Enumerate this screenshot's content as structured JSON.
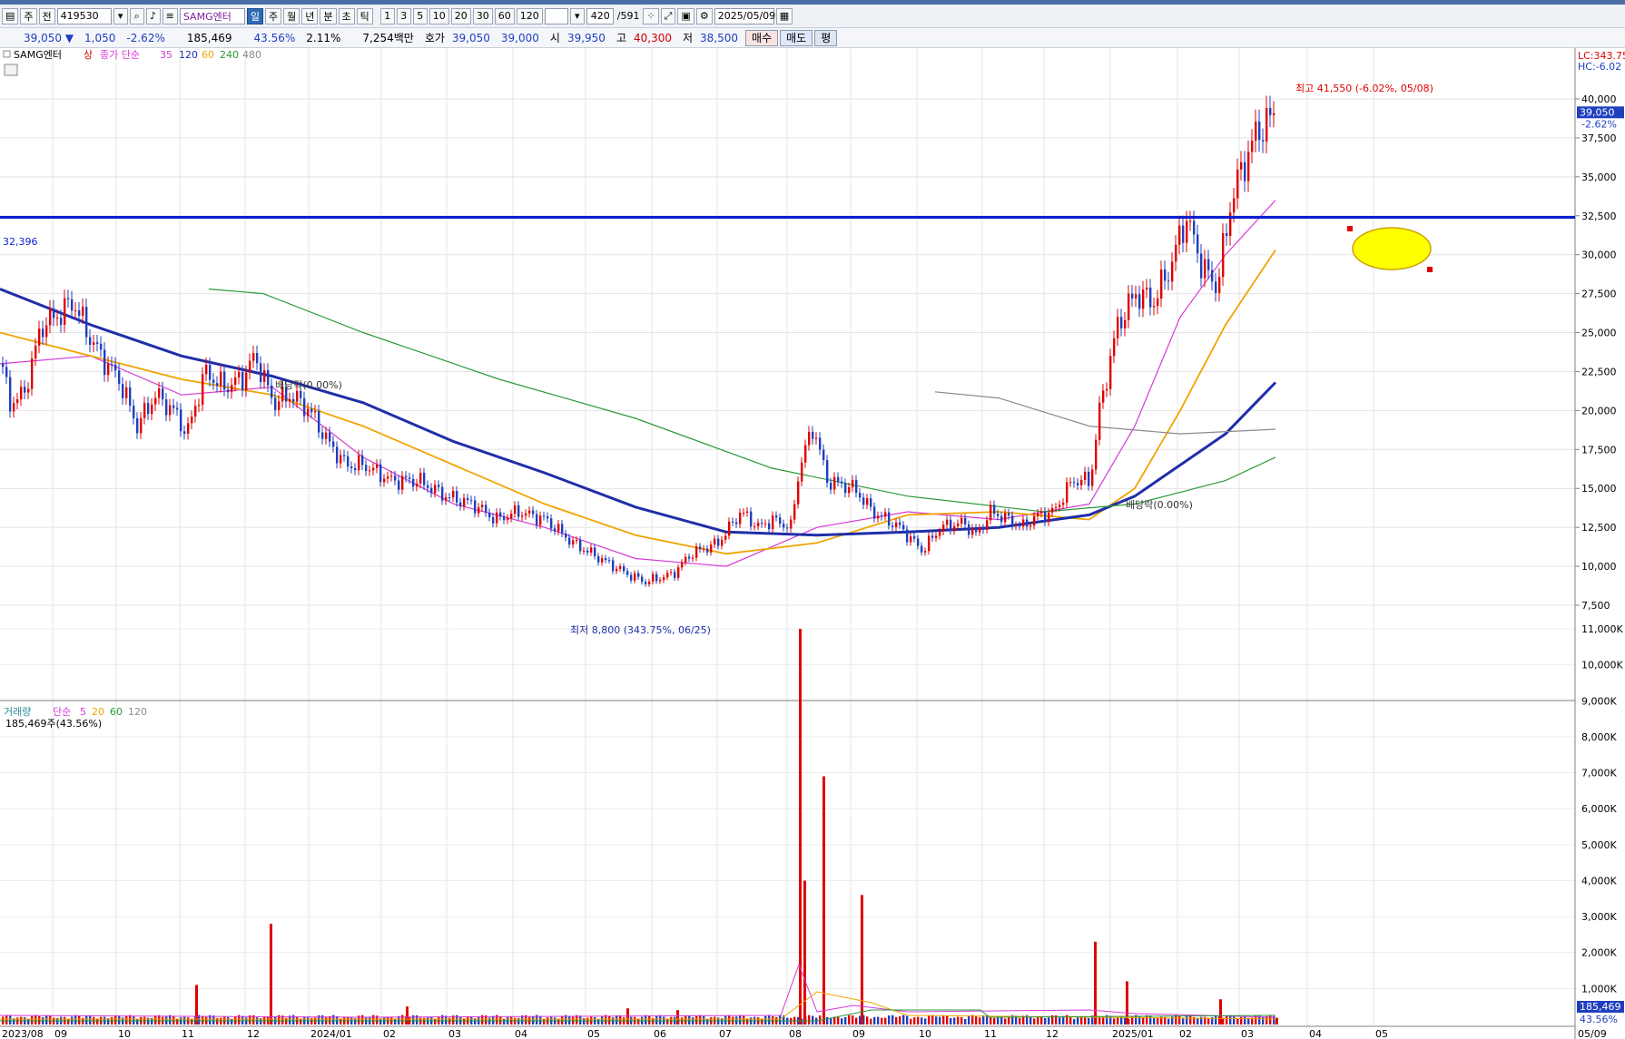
{
  "toolbar": {
    "period_mode": "주",
    "prev_label": "전",
    "code": "419530",
    "stock_name": "SAMG엔터",
    "intervals": [
      "일",
      "주",
      "월",
      "년",
      "분",
      "초",
      "틱"
    ],
    "minutes": [
      "1",
      "3",
      "5",
      "10",
      "20",
      "30",
      "60",
      "120"
    ],
    "count": "420",
    "count_total": "/591",
    "date": "2025/05/09"
  },
  "quote": {
    "price": "39,050",
    "change": "1,050",
    "change_pct": "-2.62%",
    "volume": "185,469",
    "volume_pct": "43.56%",
    "turnover": "2.11%",
    "amount": "7,254백만",
    "ask_label": "호가",
    "ask": "39,050",
    "bid": "39,000",
    "open_label": "시",
    "open": "39,950",
    "high_label": "고",
    "high": "40,300",
    "low_label": "저",
    "low": "38,500",
    "buy": "매수",
    "sell": "매도",
    "eval": "평"
  },
  "price_panel": {
    "legend_name": "SAMG엔터",
    "legend_state": "상",
    "legend_ma": "종가 단순",
    "ma_periods": [
      "35",
      "120",
      "60",
      "240",
      "480"
    ],
    "ma_colors": [
      "#d63ad6",
      "#1f2ea8",
      "#f0a400",
      "#2a9a3a",
      "#8a8a8a"
    ],
    "top_right_1": "LC:343.75",
    "top_right_2": "HC:-6.02",
    "current_price_tag": "39,050",
    "current_pct_tag": "-2.62%",
    "hline_label": "32,396",
    "high_note": "최고 41,550 (-6.02%, 05/08)",
    "low_note": "최저 8,800 (343.75%, 06/25)",
    "dividend_note_1": "배당락(0.00%)",
    "dividend_note_2": "배당락(0.00%)",
    "y_ticks": [
      "40,000",
      "37,500",
      "35,000",
      "32,500",
      "30,000",
      "27,500",
      "25,000",
      "22,500",
      "20,000",
      "17,500",
      "15,000",
      "12,500",
      "10,000",
      "7,500"
    ]
  },
  "volume_panel": {
    "legend_name": "거래량",
    "legend_ma": "단순",
    "ma_periods": [
      "5",
      "20",
      "60",
      "120"
    ],
    "info": "185,469주(43.56%)",
    "y_ticks": [
      "11,000K",
      "10,000K",
      "9,000K",
      "8,000K",
      "7,000K",
      "6,000K",
      "5,000K",
      "4,000K",
      "3,000K",
      "2,000K",
      "1,000K"
    ],
    "current_tag": "185,469",
    "current_pct_tag": "43.56%"
  },
  "x_axis": [
    "2023/08",
    "09",
    "10",
    "11",
    "12",
    "2024/01",
    "02",
    "03",
    "04",
    "05",
    "06",
    "07",
    "08",
    "09",
    "10",
    "11",
    "12",
    "2025/01",
    "02",
    "03",
    "04",
    "05",
    "05/09"
  ],
  "chart_data": {
    "type": "candlestick",
    "series": [
      {
        "name": "SAMG엔터",
        "points": [
          [
            0,
            23000
          ],
          [
            10,
            20500
          ],
          [
            25,
            21000
          ],
          [
            45,
            25500
          ],
          [
            60,
            26000
          ],
          [
            80,
            27000
          ],
          [
            95,
            25000
          ],
          [
            110,
            23500
          ],
          [
            130,
            22000
          ],
          [
            150,
            19000
          ],
          [
            170,
            21000
          ],
          [
            190,
            20000
          ],
          [
            205,
            18500
          ],
          [
            225,
            22500
          ],
          [
            245,
            21500
          ],
          [
            265,
            22000
          ],
          [
            280,
            23500
          ],
          [
            300,
            20500
          ],
          [
            320,
            21000
          ],
          [
            340,
            20000
          ],
          [
            360,
            18000
          ],
          [
            380,
            16500
          ],
          [
            400,
            16500
          ],
          [
            430,
            15500
          ],
          [
            460,
            15500
          ],
          [
            490,
            14500
          ],
          [
            520,
            14000
          ],
          [
            545,
            13000
          ],
          [
            570,
            13500
          ],
          [
            600,
            13000
          ],
          [
            630,
            11500
          ],
          [
            660,
            10500
          ],
          [
            690,
            9500
          ],
          [
            710,
            9000
          ],
          [
            740,
            9500
          ],
          [
            760,
            10800
          ],
          [
            790,
            11500
          ],
          [
            815,
            13500
          ],
          [
            835,
            12500
          ],
          [
            850,
            13000
          ],
          [
            870,
            12500
          ],
          [
            880,
            16500
          ],
          [
            895,
            19000
          ],
          [
            910,
            15500
          ],
          [
            940,
            15000
          ],
          [
            960,
            13500
          ],
          [
            990,
            12500
          ],
          [
            1015,
            11000
          ],
          [
            1035,
            12500
          ],
          [
            1060,
            12800
          ],
          [
            1075,
            12000
          ],
          [
            1090,
            13500
          ],
          [
            1110,
            13000
          ],
          [
            1125,
            12500
          ],
          [
            1140,
            13200
          ],
          [
            1160,
            13500
          ],
          [
            1180,
            15500
          ],
          [
            1200,
            15500
          ],
          [
            1210,
            20000
          ],
          [
            1230,
            25500
          ],
          [
            1250,
            27500
          ],
          [
            1270,
            27000
          ],
          [
            1290,
            29500
          ],
          [
            1305,
            32500
          ],
          [
            1325,
            29000
          ],
          [
            1340,
            28000
          ],
          [
            1355,
            33500
          ],
          [
            1370,
            36000
          ],
          [
            1385,
            38000
          ],
          [
            1395,
            38500
          ],
          [
            1405,
            39050
          ]
        ]
      },
      {
        "name": "35",
        "points": [
          [
            0,
            23000
          ],
          [
            100,
            23500
          ],
          [
            200,
            21000
          ],
          [
            300,
            21500
          ],
          [
            400,
            17000
          ],
          [
            500,
            14000
          ],
          [
            600,
            12500
          ],
          [
            700,
            10500
          ],
          [
            800,
            10000
          ],
          [
            900,
            12500
          ],
          [
            1000,
            13500
          ],
          [
            1100,
            13000
          ],
          [
            1200,
            14000
          ],
          [
            1250,
            19000
          ],
          [
            1300,
            26000
          ],
          [
            1350,
            30000
          ],
          [
            1405,
            33500
          ]
        ]
      },
      {
        "name": "60",
        "points": [
          [
            0,
            25000
          ],
          [
            100,
            23500
          ],
          [
            200,
            22000
          ],
          [
            300,
            21000
          ],
          [
            400,
            19000
          ],
          [
            500,
            16500
          ],
          [
            600,
            14000
          ],
          [
            700,
            12000
          ],
          [
            800,
            10800
          ],
          [
            900,
            11500
          ],
          [
            1000,
            13300
          ],
          [
            1100,
            13500
          ],
          [
            1200,
            13000
          ],
          [
            1250,
            15000
          ],
          [
            1300,
            20000
          ],
          [
            1350,
            25500
          ],
          [
            1405,
            30300
          ]
        ]
      },
      {
        "name": "120",
        "points": [
          [
            0,
            27800
          ],
          [
            100,
            25500
          ],
          [
            200,
            23500
          ],
          [
            300,
            22200
          ],
          [
            400,
            20500
          ],
          [
            500,
            18000
          ],
          [
            600,
            16000
          ],
          [
            700,
            13800
          ],
          [
            800,
            12200
          ],
          [
            900,
            12000
          ],
          [
            1000,
            12200
          ],
          [
            1100,
            12500
          ],
          [
            1200,
            13300
          ],
          [
            1250,
            14500
          ],
          [
            1300,
            16500
          ],
          [
            1350,
            18500
          ],
          [
            1405,
            21800
          ]
        ]
      },
      {
        "name": "240",
        "points": [
          [
            230,
            27800
          ],
          [
            290,
            27500
          ],
          [
            400,
            25000
          ],
          [
            550,
            22000
          ],
          [
            700,
            19500
          ],
          [
            850,
            16300
          ],
          [
            1000,
            14500
          ],
          [
            1150,
            13500
          ],
          [
            1250,
            14000
          ],
          [
            1350,
            15500
          ],
          [
            1405,
            17000
          ]
        ]
      },
      {
        "name": "480",
        "points": [
          [
            1030,
            21200
          ],
          [
            1100,
            20800
          ],
          [
            1200,
            19000
          ],
          [
            1300,
            18500
          ],
          [
            1405,
            18800
          ]
        ]
      }
    ],
    "horizontal_line": 32396,
    "ylim": [
      7500,
      41550
    ],
    "volume": {
      "ylim": [
        0,
        11000
      ],
      "unit": "K",
      "spikes": [
        [
          215,
          1100
        ],
        [
          297,
          2800
        ],
        [
          447,
          500
        ],
        [
          690,
          450
        ],
        [
          745,
          400
        ],
        [
          880,
          11000
        ],
        [
          885,
          4000
        ],
        [
          906,
          6900
        ],
        [
          948,
          3600
        ],
        [
          1205,
          2300
        ],
        [
          1240,
          1200
        ],
        [
          1343,
          700
        ],
        [
          1405,
          185
        ]
      ]
    }
  }
}
